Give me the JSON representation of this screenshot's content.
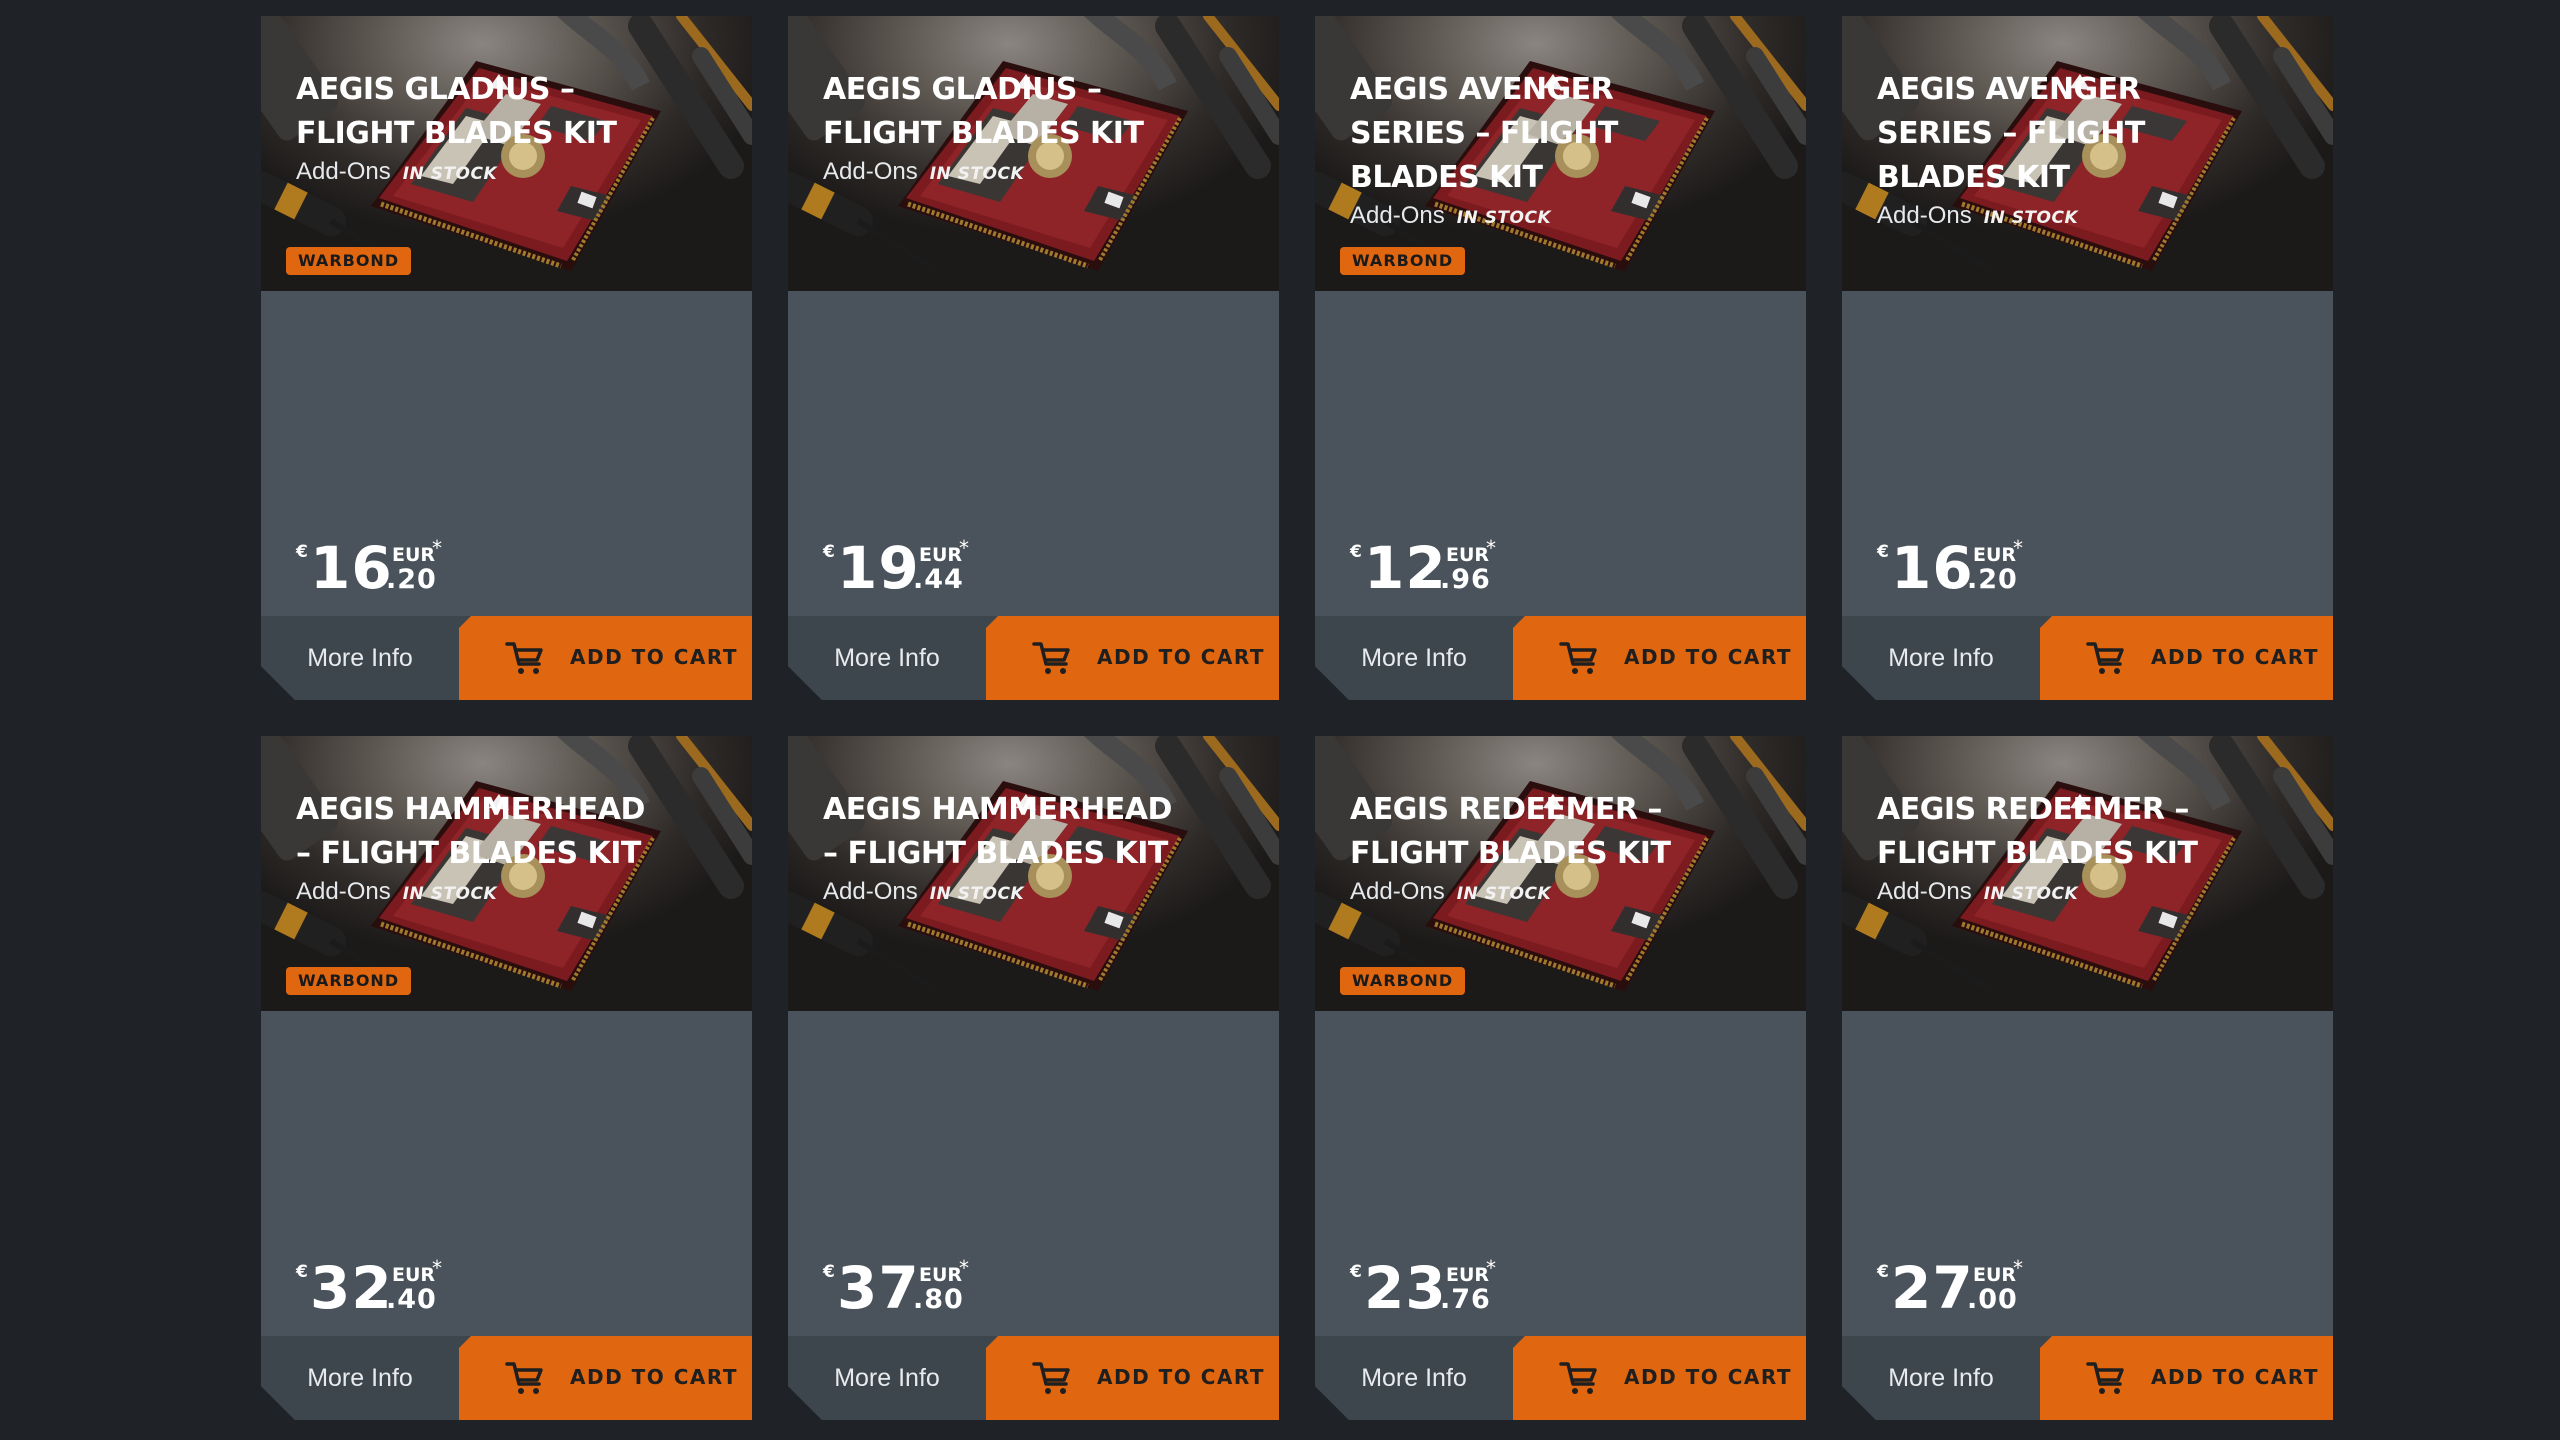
{
  "products": [
    {
      "title": "AEGIS GLADIUS – FLIGHT BLADES KIT",
      "title_lines": [
        "AEGIS GLADIUS –",
        "FLIGHT BLADES KIT"
      ],
      "category": "Add-Ons",
      "stock": "IN STOCK",
      "badge": "WARBOND",
      "currency_symbol": "€",
      "price_whole": "16",
      "price_cents": ".20",
      "currency": "EUR",
      "asterisk": "*",
      "more_info": "More Info",
      "add_to_cart": "ADD TO CART"
    },
    {
      "title": "AEGIS GLADIUS – FLIGHT BLADES KIT",
      "title_lines": [
        "AEGIS GLADIUS –",
        "FLIGHT BLADES KIT"
      ],
      "category": "Add-Ons",
      "stock": "IN STOCK",
      "badge": "",
      "currency_symbol": "€",
      "price_whole": "19",
      "price_cents": ".44",
      "currency": "EUR",
      "asterisk": "*",
      "more_info": "More Info",
      "add_to_cart": "ADD TO CART"
    },
    {
      "title": "AEGIS AVENGER SERIES – FLIGHT BLADES KIT",
      "title_lines": [
        "AEGIS AVENGER",
        "SERIES – FLIGHT",
        "BLADES KIT"
      ],
      "category": "Add-Ons",
      "stock": "IN STOCK",
      "badge": "WARBOND",
      "currency_symbol": "€",
      "price_whole": "12",
      "price_cents": ".96",
      "currency": "EUR",
      "asterisk": "*",
      "more_info": "More Info",
      "add_to_cart": "ADD TO CART"
    },
    {
      "title": "AEGIS AVENGER SERIES – FLIGHT BLADES KIT",
      "title_lines": [
        "AEGIS AVENGER",
        "SERIES – FLIGHT",
        "BLADES KIT"
      ],
      "category": "Add-Ons",
      "stock": "IN STOCK",
      "badge": "",
      "currency_symbol": "€",
      "price_whole": "16",
      "price_cents": ".20",
      "currency": "EUR",
      "asterisk": "*",
      "more_info": "More Info",
      "add_to_cart": "ADD TO CART"
    },
    {
      "title": "AEGIS HAMMERHEAD – FLIGHT BLADES KIT",
      "title_lines": [
        "AEGIS HAMMERHEAD",
        "– FLIGHT BLADES KIT"
      ],
      "category": "Add-Ons",
      "stock": "IN STOCK",
      "badge": "WARBOND",
      "currency_symbol": "€",
      "price_whole": "32",
      "price_cents": ".40",
      "currency": "EUR",
      "asterisk": "*",
      "more_info": "More Info",
      "add_to_cart": "ADD TO CART"
    },
    {
      "title": "AEGIS HAMMERHEAD – FLIGHT BLADES KIT",
      "title_lines": [
        "AEGIS HAMMERHEAD",
        "– FLIGHT BLADES KIT"
      ],
      "category": "Add-Ons",
      "stock": "IN STOCK",
      "badge": "",
      "currency_symbol": "€",
      "price_whole": "37",
      "price_cents": ".80",
      "currency": "EUR",
      "asterisk": "*",
      "more_info": "More Info",
      "add_to_cart": "ADD TO CART"
    },
    {
      "title": "AEGIS REDEEMER – FLIGHT BLADES KIT",
      "title_lines": [
        "AEGIS REDEEMER –",
        "FLIGHT BLADES KIT"
      ],
      "category": "Add-Ons",
      "stock": "IN STOCK",
      "badge": "WARBOND",
      "currency_symbol": "€",
      "price_whole": "23",
      "price_cents": ".76",
      "currency": "EUR",
      "asterisk": "*",
      "more_info": "More Info",
      "add_to_cart": "ADD TO CART"
    },
    {
      "title": "AEGIS REDEEMER – FLIGHT BLADES KIT",
      "title_lines": [
        "AEGIS REDEEMER –",
        "FLIGHT BLADES KIT"
      ],
      "category": "Add-Ons",
      "stock": "IN STOCK",
      "badge": "",
      "currency_symbol": "€",
      "price_whole": "27",
      "price_cents": ".00",
      "currency": "EUR",
      "asterisk": "*",
      "more_info": "More Info",
      "add_to_cart": "ADD TO CART"
    }
  ],
  "icons": {
    "cart": "shopping-cart-icon"
  },
  "colors": {
    "accent": "#e0660f",
    "card_bg": "#4a535b",
    "page_bg": "#1f2328",
    "footer_bg": "#3d454d"
  }
}
